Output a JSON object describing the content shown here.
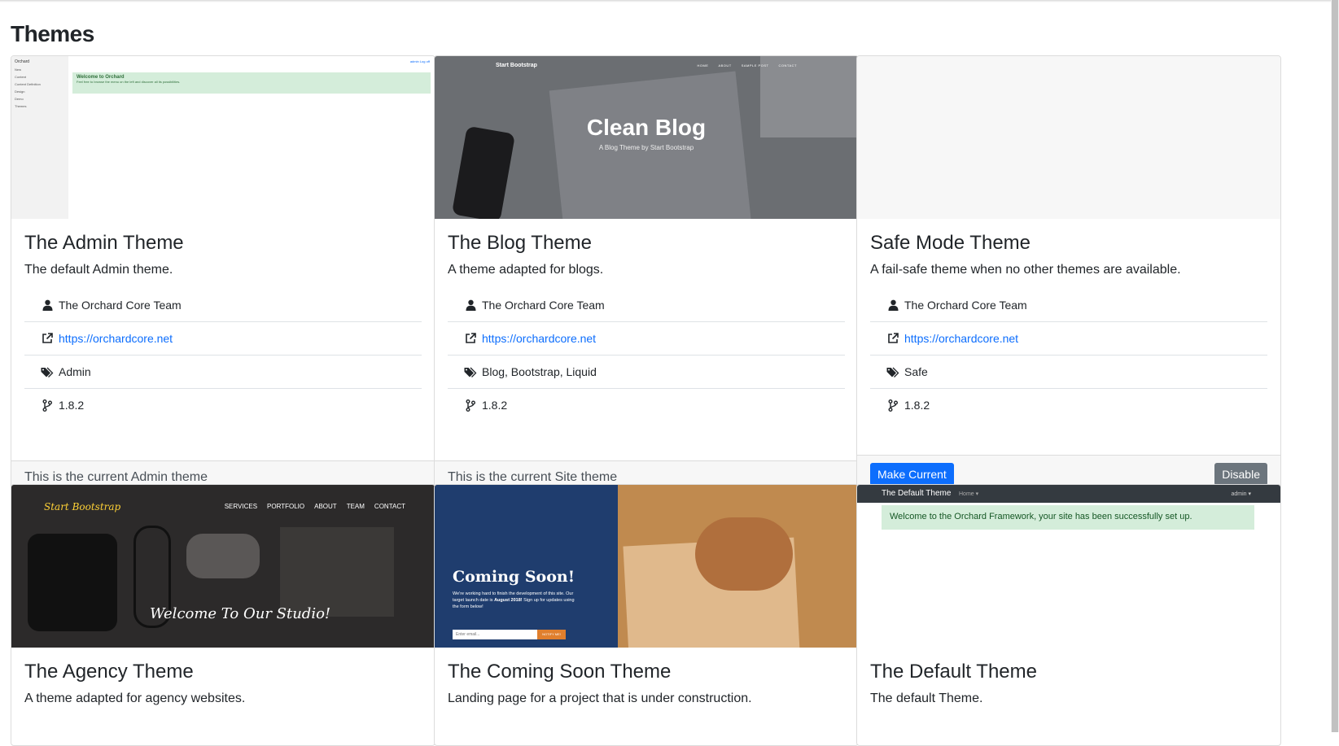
{
  "page": {
    "title": "Themes"
  },
  "cards": [
    {
      "title": "The Admin Theme",
      "description": "The default Admin theme.",
      "author": "The Orchard Core Team",
      "url": "https://orchardcore.net",
      "tags": "Admin",
      "version": "1.8.2",
      "footer": "This is the current Admin theme",
      "preview": {
        "brand": "Orchard",
        "login": "admin  Log off",
        "welcome_title": "Welcome to Orchard",
        "welcome_text": "Feel free to browse the menu on the left and discover all its possibilities.",
        "menu": [
          "New",
          "Content",
          "Content Definition",
          "Design",
          "Demo",
          "Themes"
        ]
      }
    },
    {
      "title": "The Blog Theme",
      "description": "A theme adapted for blogs.",
      "author": "The Orchard Core Team",
      "url": "https://orchardcore.net",
      "tags": "Blog, Bootstrap, Liquid",
      "version": "1.8.2",
      "footer": "This is the current Site theme",
      "preview": {
        "brand": "Start Bootstrap",
        "menu": [
          "HOME",
          "ABOUT",
          "SAMPLE POST",
          "CONTACT"
        ],
        "heading": "Clean Blog",
        "subheading": "A Blog Theme by Start Bootstrap"
      }
    },
    {
      "title": "Safe Mode Theme",
      "description": "A fail-safe theme when no other themes are available.",
      "author": "The Orchard Core Team",
      "url": "https://orchardcore.net",
      "tags": "Safe",
      "version": "1.8.2",
      "make_current_label": "Make Current",
      "disable_label": "Disable"
    },
    {
      "title": "The Agency Theme",
      "description": "A theme adapted for agency websites.",
      "preview": {
        "brand": "Start Bootstrap",
        "menu": [
          "SERVICES",
          "PORTFOLIO",
          "ABOUT",
          "TEAM",
          "CONTACT"
        ],
        "tagline": "Welcome To Our Studio!"
      }
    },
    {
      "title": "The Coming Soon Theme",
      "description": "Landing page for a project that is under construction.",
      "preview": {
        "heading": "Coming Soon!",
        "text_1": "We're working hard to finish the development of this site. Our target launch date is",
        "text_date": "August 2018!",
        "text_2": "Sign up for updates using the form below!",
        "input_placeholder": "Enter email...",
        "button": "NOTIFY ME!"
      }
    },
    {
      "title": "The Default Theme",
      "description": "The default Theme.",
      "preview": {
        "brand": "The Default Theme",
        "home": "Home ▾",
        "admin": "admin ▾",
        "welcome": "Welcome to the Orchard Framework, your site has been successfully set up."
      }
    }
  ]
}
